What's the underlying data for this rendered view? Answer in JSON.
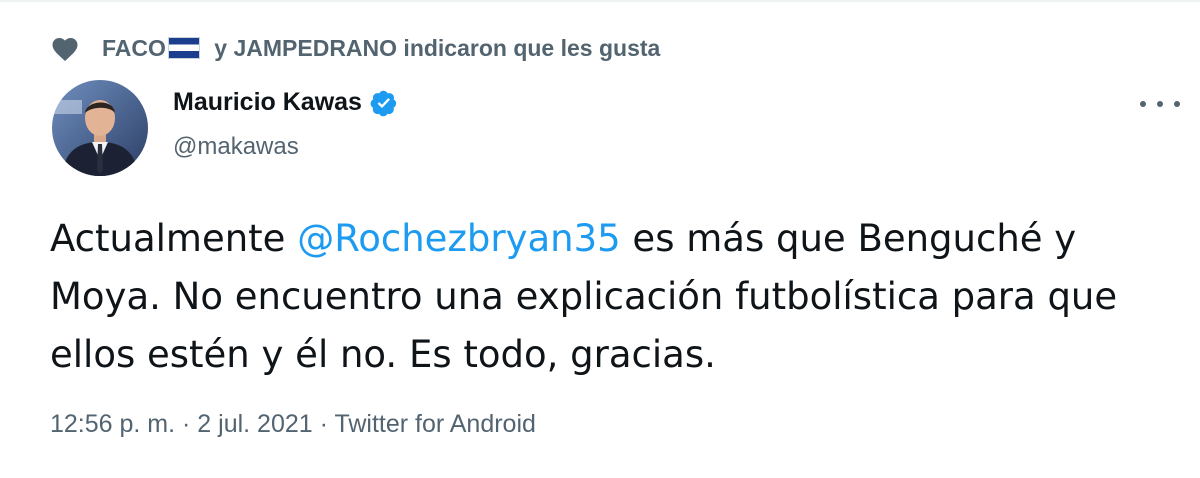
{
  "social_context": {
    "user1": "FACO",
    "middle": " y JAMPEDRANO indicaron que les gusta",
    "icon": "heart-icon",
    "flag_icon": "flag-icon"
  },
  "author": {
    "name": "Mauricio Kawas",
    "handle": "@makawas",
    "verified_icon": "verified-badge-icon",
    "avatar_icon": "avatar-photo"
  },
  "tweet": {
    "text_part1": "Actualmente ",
    "mention": "@Rochezbryan35",
    "text_part2": " es más que Benguché y Moya. No encuentro una explicación futbolística para que ellos estén y él no. Es todo, gracias."
  },
  "meta": {
    "time": "12:56 p. m.",
    "separator1": " · ",
    "date": "2 jul. 2021",
    "separator2": " · ",
    "source": "Twitter for Android"
  },
  "more_options_icon": "more-horizontal-icon",
  "colors": {
    "accent": "#1d9bf0",
    "secondary_text": "#536471",
    "primary_text": "#0f1419"
  }
}
